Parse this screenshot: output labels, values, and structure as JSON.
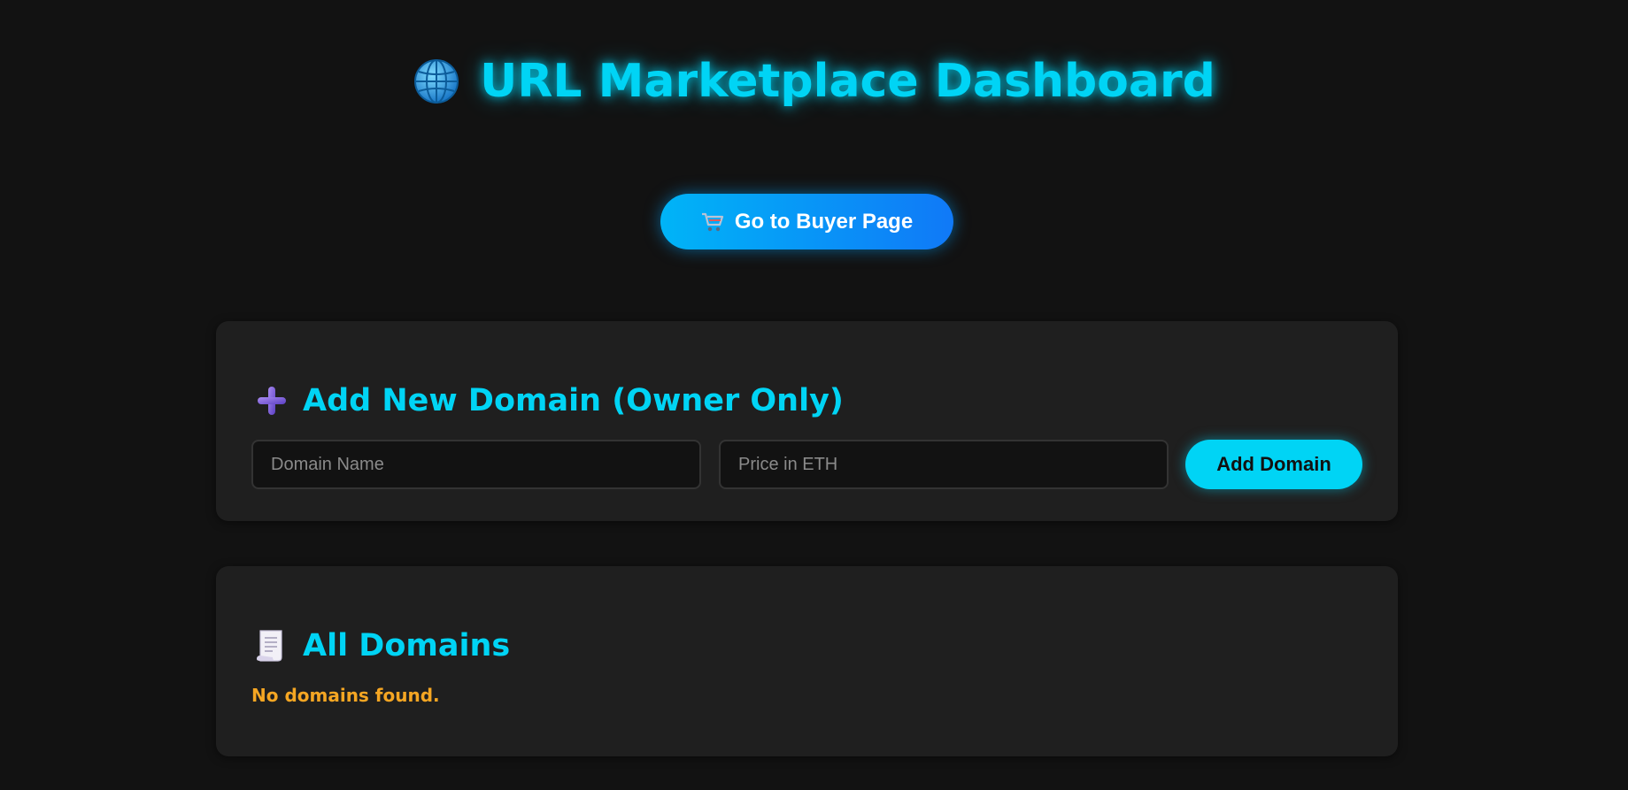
{
  "header": {
    "title": "URL Marketplace Dashboard",
    "icon": "globe-icon"
  },
  "nav": {
    "buyer_button_label": "Go to Buyer Page",
    "buyer_button_icon": "cart-icon"
  },
  "add_domain": {
    "heading": "Add New Domain (Owner Only)",
    "heading_icon": "plus-icon",
    "domain_input": {
      "value": "",
      "placeholder": "Domain Name"
    },
    "price_input": {
      "value": "",
      "placeholder": "Price in ETH"
    },
    "submit_label": "Add Domain"
  },
  "domains": {
    "heading": "All Domains",
    "heading_icon": "document-icon",
    "empty_message": "No domains found."
  },
  "colors": {
    "accent": "#00d4f5",
    "background": "#121212",
    "card": "#1f1f1f",
    "warning": "#f5a623",
    "button_gradient_start": "#00b4f7",
    "button_gradient_end": "#1079f7"
  }
}
